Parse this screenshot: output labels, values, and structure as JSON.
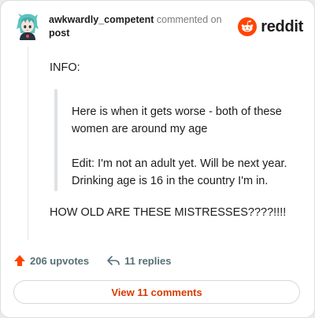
{
  "header": {
    "username": "awkwardly_competent",
    "action_text": "commented on",
    "post_link": "post",
    "brand_wordmark": "reddit",
    "avatar_icon": "anime-avatar-icon",
    "brand_icon": "reddit-snoo-icon"
  },
  "comment": {
    "info_label": "INFO:",
    "quote_paragraphs": [
      "Here is when it gets worse - both of these women are around my age",
      "Edit: I'm not an adult yet. Will be next year. Drinking age is 16 in the country I'm in."
    ],
    "closing_line": "HOW OLD ARE THESE MISTRESSES????!!!!"
  },
  "actions": {
    "upvotes_label": "206 upvotes",
    "replies_label": "11 replies",
    "upvote_icon": "upvote-arrow-icon",
    "reply_icon": "reply-arrow-icon"
  },
  "view_button": {
    "label": "View 11 comments"
  },
  "colors": {
    "brand_orange": "#ff4500",
    "action_gray": "#576f76",
    "link_orange": "#d93a00",
    "avatar_teal": "#4fb7b3"
  }
}
